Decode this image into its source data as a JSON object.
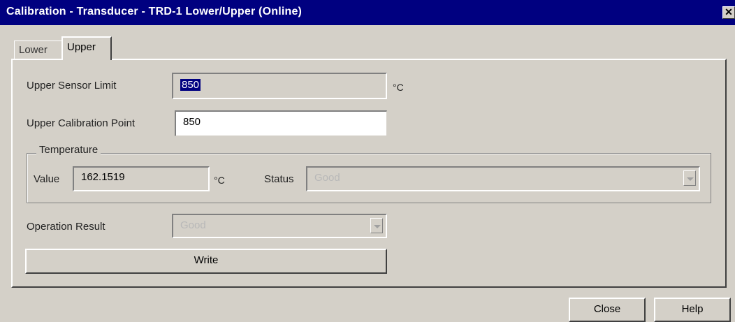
{
  "window": {
    "title": "Calibration - Transducer - TRD-1 Lower/Upper  (Online)",
    "close_glyph": "✕"
  },
  "tabs": [
    {
      "label": "Lower"
    },
    {
      "label": "Upper"
    }
  ],
  "upper_sensor_limit": {
    "label": "Upper Sensor Limit",
    "value": "850",
    "unit": "°C"
  },
  "upper_calibration_point": {
    "label": "Upper Calibration Point",
    "value": "850"
  },
  "temperature": {
    "title": "Temperature",
    "value_label": "Value",
    "value": "162.1519",
    "unit": "°C",
    "status_label": "Status",
    "status": "Good"
  },
  "operation_result": {
    "label": "Operation Result",
    "value": "Good"
  },
  "buttons": {
    "write": "Write",
    "close": "Close",
    "help": "Help"
  },
  "colors": {
    "titlebar": "#000080",
    "face": "#d4d0c8",
    "selection": "#000080"
  }
}
